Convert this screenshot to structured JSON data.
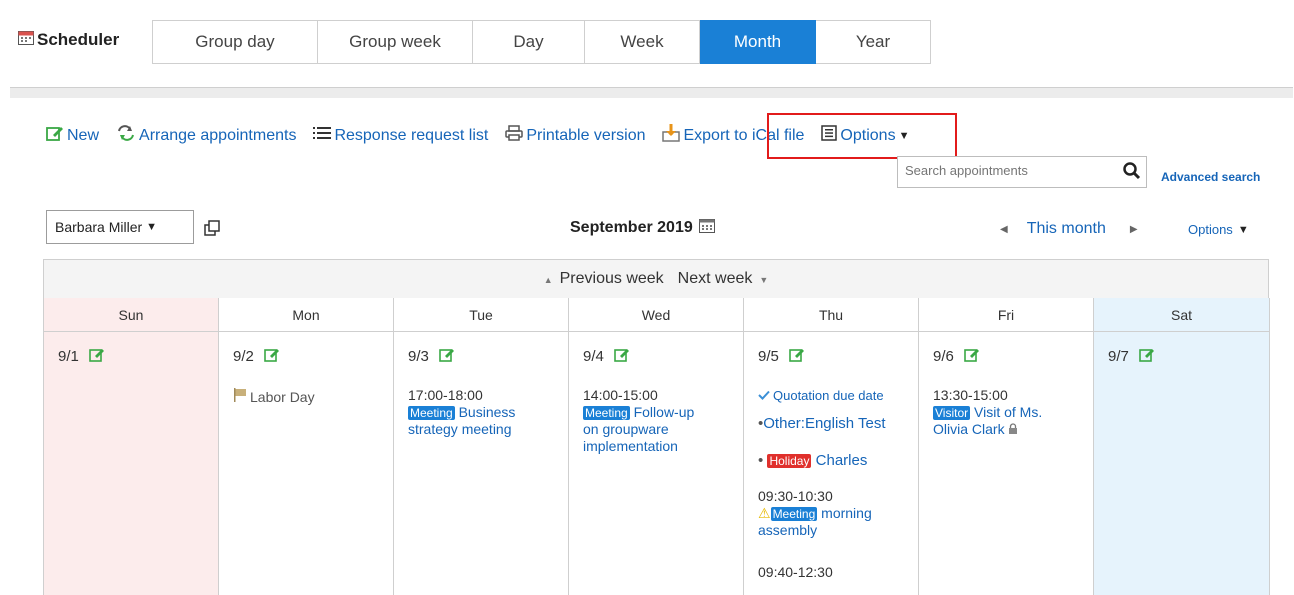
{
  "app": {
    "title": "Scheduler"
  },
  "tabs": [
    {
      "label": "Group day"
    },
    {
      "label": "Group week"
    },
    {
      "label": "Day"
    },
    {
      "label": "Week"
    },
    {
      "label": "Month",
      "active": true
    },
    {
      "label": "Year"
    }
  ],
  "toolbar": {
    "new": "New",
    "arrange": "Arrange appointments",
    "response": "Response request list",
    "printable": "Printable version",
    "export": "Export to iCal file",
    "options": "Options"
  },
  "search": {
    "placeholder": "Search appointments",
    "advanced": "Advanced search"
  },
  "user_select": {
    "value": "Barbara Miller"
  },
  "month_title": "September 2019",
  "nav": {
    "this_month": "This month",
    "options": "Options"
  },
  "weeknav": {
    "prev": "Previous week",
    "next": "Next week"
  },
  "days": [
    {
      "name": "Sun",
      "date": "9/1"
    },
    {
      "name": "Mon",
      "date": "9/2"
    },
    {
      "name": "Tue",
      "date": "9/3"
    },
    {
      "name": "Wed",
      "date": "9/4"
    },
    {
      "name": "Thu",
      "date": "9/5"
    },
    {
      "name": "Fri",
      "date": "9/6"
    },
    {
      "name": "Sat",
      "date": "9/7"
    }
  ],
  "events": {
    "mon_holiday": "Labor Day",
    "tue": {
      "time": "17:00-18:00",
      "tag": "Meeting",
      "title1": "Business",
      "title2": "strategy meeting"
    },
    "wed": {
      "time": "14:00-15:00",
      "tag": "Meeting",
      "title1": "Follow-up",
      "title2": "on groupware",
      "title3": "implementation"
    },
    "thu": {
      "todo": "Quotation due date",
      "other": "Other:English Test",
      "holiday_tag": "Holiday",
      "holiday_name": "Charles",
      "time1": "09:30-10:30",
      "tag1": "Meeting",
      "title1a": "morning",
      "title1b": "assembly",
      "time2": "09:40-12:30"
    },
    "fri": {
      "time": "13:30-15:00",
      "tag": "Visitor",
      "title1": "Visit of Ms.",
      "title2": "Olivia Clark"
    }
  },
  "colors": {
    "accent": "#1a80d6",
    "link": "#1665b8",
    "highlight": "#e21b1b",
    "sunday_bg": "#fcecec",
    "saturday_bg": "#e6f3fc"
  }
}
